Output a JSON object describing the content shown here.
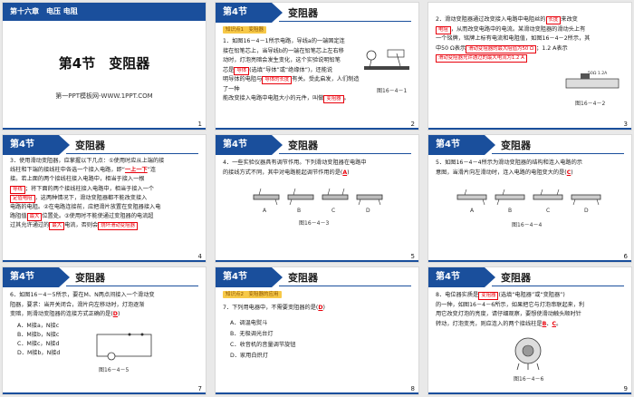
{
  "s1": {
    "chapter": "第十六章　电压 电阻",
    "title": "第4节　变阻器",
    "sub": "第一PPT模板网-WWW.1PPT.COM",
    "num": "1"
  },
  "header": {
    "section": "第4节",
    "title": "变阻器"
  },
  "s2": {
    "tag": "知识点1　变阻器",
    "p1": "1．如图16－4－1所示电路，导线a的一端固定连",
    "p2": "接在铅笔芯上，当导线b的一端在铅笔芯上左右移",
    "p3": "动时，灯泡亮暗会发生变化，这个实验说明铅笔",
    "p4a": "芯是",
    "fill1": "导体",
    "p4b": "(选填“导体”或“绝缘体”)，还能说",
    "p5a": "明导体的电阻与",
    "fill2": "导体的长度",
    "p5b": "有关。受此启发，人们制造了一种",
    "p6a": "能改变接入电路中电阻大小的元件，叫做",
    "fill3": "变阻器",
    "p6b": "。",
    "fig": "图16－4－1",
    "num": "2"
  },
  "s3": {
    "p1a": "2．滑动变阻器通过改变接入电路中电阻丝的",
    "fill1": "长度",
    "p1b": "来改变",
    "fill2": "电阻",
    "p2": "，从而改变电路中的电流。某滑动变阻器的滑动头上有",
    "p3": "一个铭牌，铭牌上标有电流和电阻值，如图16－4－2所示，其",
    "p4a": "中50 Ω表示",
    "fill3": "滑动变阻器的最大阻值为50 Ω",
    "p4b": "；1.2 A表示",
    "fill4": "滑动变阻器允许通过的最大电流为1.2 A",
    "fig": "图16－4－2",
    "plate": "50Ω 1.2A",
    "num": "3"
  },
  "s4": {
    "p1": "3．使用滑动变阻器，应掌握以下几点：①使用时应从上端的接",
    "p2a": "线柱和下端的接线柱中各选一个接入电路，即“",
    "fill1": "一上一下",
    "p2b": "”连",
    "p3": "接。若上面的两个接线柱接入电路中，相当于接入一根",
    "fill2": "导线",
    "p4": "；将下面的两个接线柱接入电路中，相当于接入一个",
    "fill3": "定值电阻",
    "p5": "，这两种情况下，滑动变阻器都不能改变接入",
    "p6": "电路的电阻。②在电路连接前，应把滑片放置在变阻器接入电",
    "p7a": "路阻值",
    "fill4": "最大",
    "p7b": "位置处。③使用时不能使通过变阻器的电流超",
    "p8a": "过其允许通过的",
    "fill5": "最大",
    "p8b": "电流，否则会",
    "fill6": "烧坏滑动变阻器",
    "num": "4"
  },
  "s5": {
    "p1": "4．一些实验仪器具有调节作用。下列滑动变阻器在电路中",
    "p2a": "的接线方式不同，其中对电路能起调节作用的是(",
    "ans": "A",
    "p2b": ")",
    "labels": [
      "A",
      "B",
      "C",
      "D"
    ],
    "fig": "图16－4－3",
    "num": "5"
  },
  "s6": {
    "p1": "5．如图16－4－4所示为滑动变阻器的结构和连入电路的示",
    "p2a": "意图，当滑片向左滑动时，连入电路的电阻变大的是(",
    "ans": "C",
    "p2b": ")",
    "labels": [
      "A",
      "B",
      "C",
      "D"
    ],
    "fig": "图16－4－4",
    "num": "6"
  },
  "s7": {
    "p1": "6．如图16－4－5所示，要在M、N两点间接入一个滑动变",
    "p2": "阻器，要求：当开关闭合，滑片向左移动时，灯泡逐渐",
    "p3a": "变暗，则滑动变阻器的连接方式正确的是(",
    "ans": "D",
    "p3b": ")",
    "opts": [
      "A．M接a，N接c",
      "B．M接b，N接c",
      "C．M接c，N接d",
      "D．M接b，N接d"
    ],
    "fig": "图16－4－5",
    "num": "7"
  },
  "s8": {
    "tag": "知识点2　变阻器的应用",
    "p1a": "7．下列用电器中，不需要变阻器的是(",
    "ans": "D",
    "p1b": ")",
    "opts": [
      "A．调温电熨斗",
      "B．无极调光台灯",
      "C．收音机的音量调节旋钮",
      "D．家用白炽灯"
    ],
    "num": "8"
  },
  "s9": {
    "p1a": "8．电位器实质是",
    "fill1": "变阻器",
    "p1b": "(选填“电阻器”或“变阻器”)",
    "p2": "的一种，如图16－4－6所示，如果把它与灯泡串联起来，利",
    "p3": "用它改变灯泡的亮度，请仔细观察，要想使滑动触头顺时针",
    "p4a": "转动，灯泡变亮，则应连入的两个接线柱是",
    "fill2": "B",
    "p4b": "、",
    "fill3": "C",
    "p4c": "。",
    "fig": "图16－4－6",
    "num": "9"
  }
}
